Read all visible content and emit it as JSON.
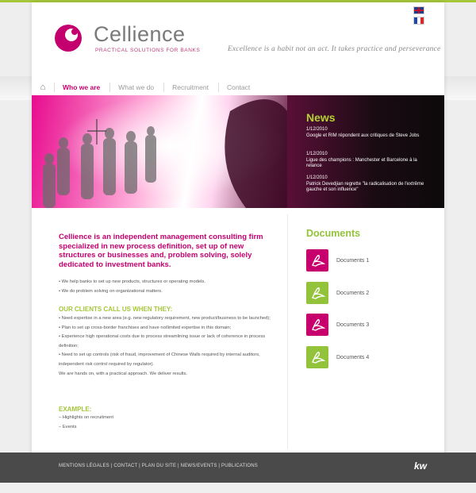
{
  "header": {
    "brand": "Cellience",
    "tagline": "PRACTICAL SOLUTIONS FOR BANKS",
    "motto": "Excellence is a habit not an act. It takes practice and perseverance",
    "languages": [
      "English",
      "Français"
    ]
  },
  "nav": {
    "home_icon": "home-icon",
    "items": [
      "Who we are",
      "What we do",
      "Recruitment",
      "Contact"
    ]
  },
  "news": {
    "title": "News",
    "items": [
      {
        "date": "1/12/2010",
        "text": "Google et RIM répondent aux critiques de Steve Jobs"
      },
      {
        "date": "1/12/2010",
        "text": "Ligue des champions : Manchester et Barcelone à la relance"
      },
      {
        "date": "1/12/2010",
        "text": "Patrick Devedjian regrette \"la radicalisation de l'extrême gauche et son influence\""
      }
    ]
  },
  "content": {
    "intro": "Cellience is an independent management consulting firm specialized in new process definition, set up of new structures or businesses and, problem solving, solely dedicated to investment banks.",
    "bullets": [
      "• We help banks to set up new products, structures or operating models.",
      "• We do problem solving on organizational matters."
    ],
    "clients_heading": "OUR CLIENTS CALL US WHEN THEY:",
    "clients": [
      "• Need expertise in a new area (e.g. new regulatory requirement, new product/business to be launched);",
      "• Plan to set up cross-border franchises and have no/limited expertise in this domain;",
      "• Experience high operational costs due to process streamlining issue or lack of coherence in process definition;",
      "• Need to set up controls (risk of fraud, improvement of Chinese Walls required by internal auditors, independent risk control required by regulator).",
      "We are hands on, with a practical approach. We deliver results."
    ],
    "example_heading": "EXAMPLE:",
    "examples": [
      "– Highlights on recruitment",
      "– Events"
    ]
  },
  "documents": {
    "title": "Documents",
    "items": [
      {
        "label": "Documents 1",
        "color": "#c8006e"
      },
      {
        "label": "Documents 2",
        "color": "#93c33b"
      },
      {
        "label": "Documents 3",
        "color": "#c8006e"
      },
      {
        "label": "Documents 4",
        "color": "#93c33b"
      }
    ]
  },
  "footer": {
    "links": [
      "MENTIONS LÉGALES",
      "CONTACT",
      "PLAN DU SITE",
      "NEWS/EVENTS",
      "PUBLICATIONS"
    ],
    "logo": "kw"
  },
  "colors": {
    "accent": "#c4006f",
    "green": "#a6c63a",
    "footer": "#4a4a4a"
  }
}
